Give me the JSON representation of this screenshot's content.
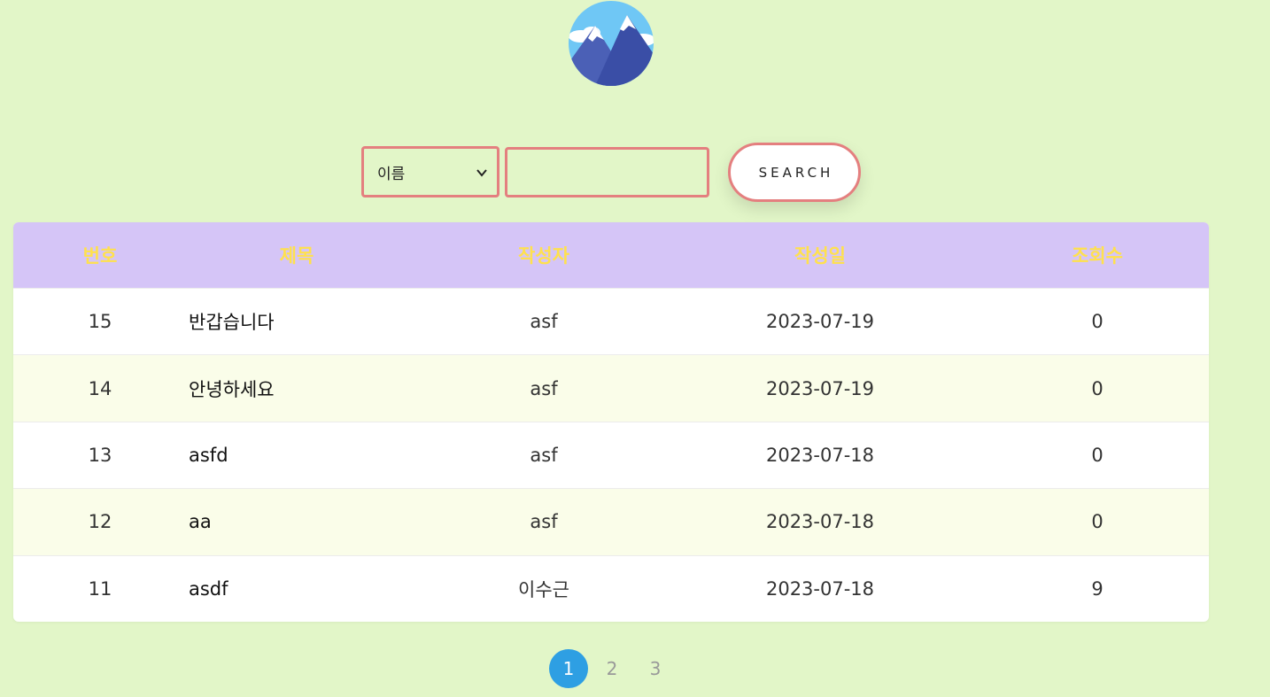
{
  "logo": {
    "icon": "mountain-logo-icon"
  },
  "search": {
    "select_value": "이름",
    "input_value": "",
    "button_label": "SEARCH"
  },
  "board": {
    "columns": [
      "번호",
      "제목",
      "작성자",
      "작성일",
      "조회수"
    ],
    "rows": [
      {
        "no": "15",
        "title": "반갑습니다",
        "writer": "asf",
        "date": "2023-07-19",
        "views": "0"
      },
      {
        "no": "14",
        "title": "안녕하세요",
        "writer": "asf",
        "date": "2023-07-19",
        "views": "0"
      },
      {
        "no": "13",
        "title": "asfd",
        "writer": "asf",
        "date": "2023-07-18",
        "views": "0"
      },
      {
        "no": "12",
        "title": "aa",
        "writer": "asf",
        "date": "2023-07-18",
        "views": "0"
      },
      {
        "no": "11",
        "title": "asdf",
        "writer": "이수근",
        "date": "2023-07-18",
        "views": "9"
      }
    ]
  },
  "pagination": {
    "pages": [
      "1",
      "2",
      "3"
    ],
    "current": "1"
  },
  "colors": {
    "background": "#e2f6c8",
    "header_bg": "#d5c5f7",
    "header_text": "#ffe14d",
    "border_accent": "#e47f7f",
    "active_page": "#2e9fe3"
  }
}
